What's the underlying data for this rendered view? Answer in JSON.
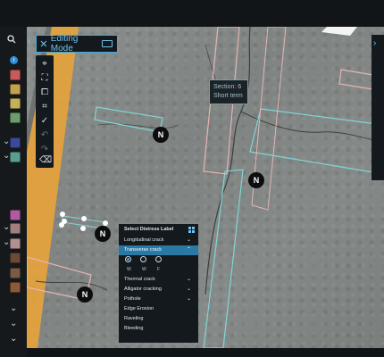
{
  "app": {
    "mode_title": "Editing Mode"
  },
  "colors": {
    "accent": "#3fa9e0",
    "selected_row": "#2a78a4",
    "box_cyan": "#7fd6d6",
    "box_pink": "#e6b4b4"
  },
  "left_sidebar": {
    "icons": [
      "search-icon",
      "info-icon"
    ],
    "swatches": [
      "#c85a5a",
      "#c4a24d",
      "#c2b05a",
      "#6b9e6a",
      "#3b4a9a",
      "#5a9e92",
      "#b05aa0",
      "#a08080",
      "#b09090",
      "#6b4a38",
      "#7a5a42",
      "#8a5a3a"
    ]
  },
  "editing_toolbar": {
    "close_icon": "close-icon",
    "keyboard_icon": "keyboard-icon"
  },
  "tools": [
    "cursor-icon",
    "bbox-icon",
    "segment-icon",
    "polygon-icon",
    "verify-icon",
    "undo-icon",
    "redo-icon",
    "eraser-icon"
  ],
  "section_tooltip": {
    "line1": "Section: 6",
    "line2": "Short term"
  },
  "markers": {
    "n1": "N",
    "n2": "N",
    "n3": "N",
    "n4": "N"
  },
  "distress_panel": {
    "title": "Select Distress Label",
    "items": [
      {
        "label": "Longitudinal crack"
      },
      {
        "label": "Transverse crack"
      },
      {
        "label": "Thermal crack"
      },
      {
        "label": "Alligator cracking"
      },
      {
        "label": "Pothole"
      },
      {
        "label": "Edge Erosion"
      },
      {
        "label": "Raveling"
      },
      {
        "label": "Bleeding"
      }
    ],
    "severity": [
      "W",
      "W",
      "F"
    ],
    "selected_severity": "W"
  }
}
